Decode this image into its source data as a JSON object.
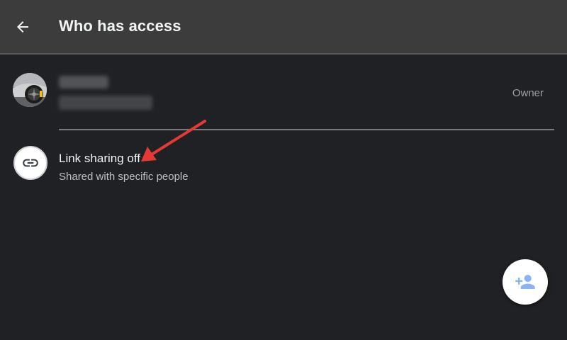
{
  "header": {
    "title": "Who has access",
    "back_icon": "arrow-back-icon"
  },
  "owner": {
    "name": "",
    "email": "",
    "role": "Owner",
    "avatar_icon": "profile-photo"
  },
  "link_sharing": {
    "title": "Link sharing off",
    "subtitle": "Shared with specific people",
    "icon": "link-icon"
  },
  "fab": {
    "icon": "add-person-icon",
    "color": "#8ab4f8"
  },
  "annotation": {
    "color": "#e53935"
  },
  "colors": {
    "background": "#202124",
    "app_bar": "#3c3c3c"
  }
}
